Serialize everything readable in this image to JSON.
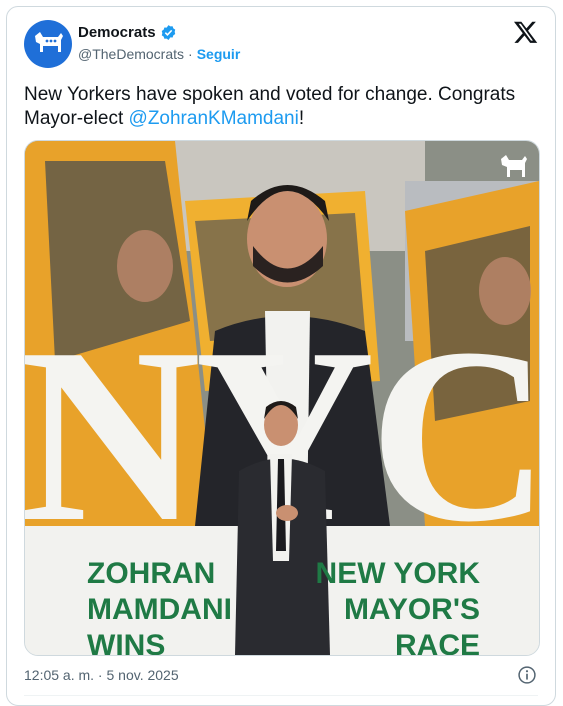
{
  "author": {
    "name": "Democrats",
    "handle": "@TheDemocrats",
    "separator": "·",
    "follow_label": "Seguir"
  },
  "tweet": {
    "text_before": "New Yorkers have spoken and voted for change. Congrats Mayor-elect ",
    "mention": "@ZohranKMamdani",
    "text_after": "!"
  },
  "media": {
    "headline": "NYC",
    "left_caption": [
      "ZOHRAN",
      "MAMDANI",
      "WINS"
    ],
    "right_caption": [
      "NEW YORK",
      "MAYOR'S",
      "RACE"
    ],
    "caption_color": "#1f7a45",
    "watermark_icon": "donkey-icon"
  },
  "meta": {
    "timestamp": "12:05 a. m. · 5 nov. 2025"
  },
  "colors": {
    "accent": "#1d9bf0",
    "brand": "#1f6fd8",
    "text": "#0f1419",
    "muted": "#536471"
  }
}
